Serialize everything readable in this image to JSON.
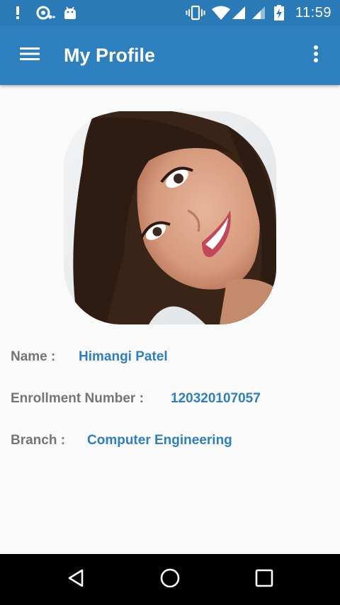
{
  "status_bar": {
    "time": "11:59",
    "left_icons": [
      "alert-icon",
      "speaker-sync-icon",
      "android-icon"
    ],
    "right_icons": [
      "vibrate-icon",
      "wifi-icon",
      "signal-icon",
      "signal-icon-2",
      "battery-charging-icon"
    ]
  },
  "app_bar": {
    "title": "My Profile",
    "menu_icon": "hamburger-menu-icon",
    "overflow_icon": "more-vert-icon"
  },
  "profile": {
    "photo": "profile-photo",
    "fields": [
      {
        "label": "Name :",
        "value": "Himangi Patel"
      },
      {
        "label": "Enrollment Number :",
        "value": "120320107057"
      },
      {
        "label": "Branch :",
        "value": "Computer Engineering"
      }
    ]
  },
  "nav_bar": {
    "buttons": [
      "back-icon",
      "home-icon",
      "recents-icon"
    ]
  },
  "colors": {
    "primary": "#2e7fbd",
    "status_bar": "#2a7ab8",
    "label_gray": "#757575",
    "background": "#fafafa"
  }
}
